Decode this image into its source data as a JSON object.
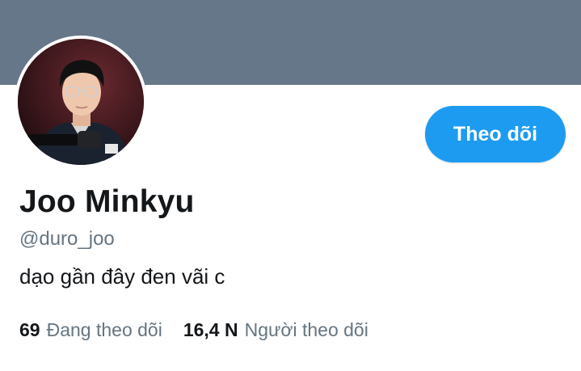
{
  "profile": {
    "banner_color": "#66778a",
    "avatar_icon": "profile-photo",
    "name": "Joo Minkyu",
    "handle": "@duro_joo",
    "bio": "dạo gần đây đen vãi c"
  },
  "actions": {
    "follow_label": "Theo dõi",
    "follow_color": "#1d9bf0"
  },
  "stats": {
    "following_count": "69",
    "following_label": "Đang theo dõi",
    "followers_count": "16,4 N",
    "followers_label": "Người theo dõi"
  }
}
